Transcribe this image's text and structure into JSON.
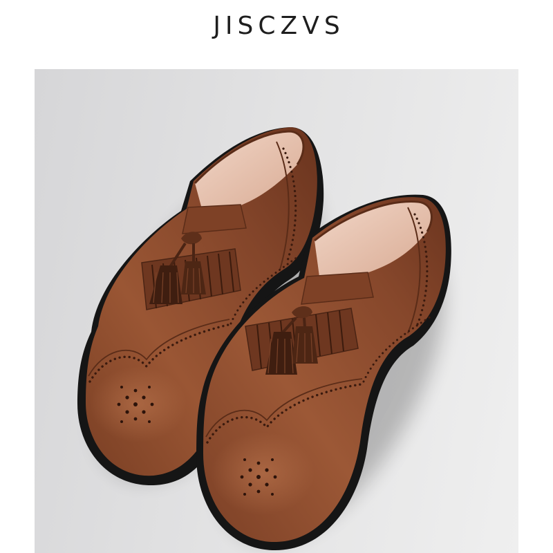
{
  "brand": {
    "title": "JISCZVS"
  },
  "colors": {
    "page_background": "#ffffff",
    "panel": "#e2e2e3",
    "leather": "#8b4a2b",
    "leather_dark": "#5e2f1a",
    "sole": "#151515",
    "lining": "#e8c5b2",
    "tassel": "#4a2414"
  }
}
